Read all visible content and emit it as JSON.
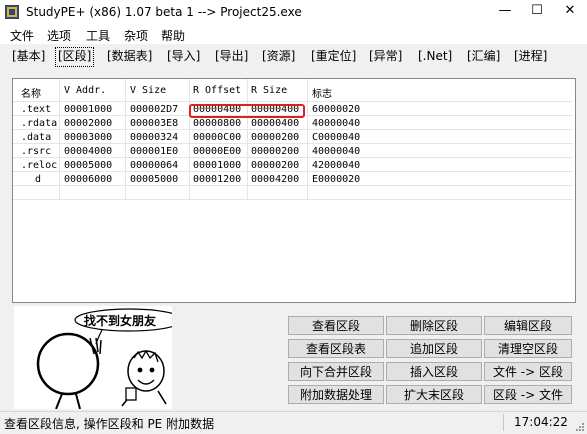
{
  "window": {
    "title": "StudyPE+ (x86) 1.07 beta 1  --> Project25.exe",
    "minimize": "—",
    "maximize": "☐",
    "close": "✕"
  },
  "menu": [
    "文件",
    "选项",
    "工具",
    "杂项",
    "帮助"
  ],
  "tabs": [
    "[基本]",
    "[区段]",
    "[数据表]",
    "[导入]",
    "[导出]",
    "[资源]",
    "[重定位]",
    "[异常]",
    "[.Net]",
    "[汇编]",
    "[进程]"
  ],
  "active_tab": "[区段]",
  "table": {
    "columns": [
      "名称",
      "V Addr.",
      "V Size",
      "R Offset",
      "R Size",
      "标志"
    ],
    "rows": [
      [
        ".text",
        "00001000",
        "000002D7",
        "00000400",
        "00000400",
        "60000020"
      ],
      [
        ".rdata",
        "00002000",
        "000003E8",
        "00000800",
        "00000400",
        "40000040"
      ],
      [
        ".data",
        "00003000",
        "00000324",
        "00000C00",
        "00000200",
        "C0000040"
      ],
      [
        ".rsrc",
        "00004000",
        "000001E0",
        "00000E00",
        "00000200",
        "40000040"
      ],
      [
        ".reloc",
        "00005000",
        "00000064",
        "00001000",
        "00000200",
        "42000040"
      ],
      [
        "d",
        "00006000",
        "00005000",
        "00001200",
        "00004200",
        "E0000020"
      ]
    ],
    "highlight_color": "#e0201e"
  },
  "meme": {
    "caption": "找不到女朋友"
  },
  "buttons": [
    "查看区段",
    "删除区段",
    "编辑区段",
    "查看区段表",
    "追加区段",
    "清理空区段",
    "向下合并区段",
    "插入区段",
    "文件 -> 区段",
    "附加数据处理",
    "扩大末区段",
    "区段 -> 文件"
  ],
  "status": {
    "message": "查看区段信息, 操作区段和 PE 附加数据",
    "time": "17:04:22"
  }
}
